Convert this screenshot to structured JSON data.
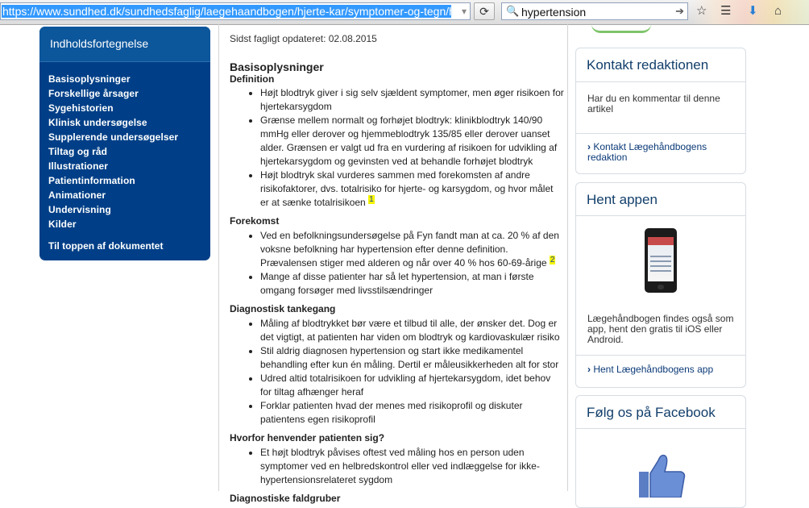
{
  "browser": {
    "url": "https://www.sundhed.dk/sundhedsfaglig/laegehaandbogen/hjerte-kar/symptomer-og-tegn/hoejt",
    "search_value": "hypertension"
  },
  "toc": {
    "title": "Indholdsfortegnelse",
    "items": [
      "Basisoplysninger",
      "Forskellige årsager",
      "Sygehistorien",
      "Klinisk undersøgelse",
      "Supplerende undersøgelser",
      "Tiltag og råd",
      "Illustrationer",
      "Patientinformation",
      "Animationer",
      "Undervisning",
      "Kilder"
    ],
    "to_top": "Til toppen af dokumentet"
  },
  "main": {
    "updated": "Sidst fagligt opdateret: 02.08.2015",
    "section_title": "Basisoplysninger",
    "definition": {
      "title": "Definition",
      "items": [
        "Højt blodtryk giver i sig selv sjældent symptomer, men øger risikoen for hjertekarsygdom",
        "Grænse mellem normalt og forhøjet blodtryk: klinikblodtryk 140/90 mmHg eller derover og hjemmeblodtryk 135/85 eller derover uanset alder. Grænsen er valgt ud fra en vurdering af risikoen for udvikling af hjertekarsygdom og gevinsten ved at behandle forhøjet blodtryk",
        "Højt blodtryk skal vurderes sammen med forekomsten af andre risikofaktorer, dvs. totalrisiko for hjerte- og karsygdom, og hvor målet er at sænke totalrisikoen"
      ],
      "ref": "1"
    },
    "forekomst": {
      "title": "Forekomst",
      "items": [
        "Ved en befolkningsundersøgelse på Fyn fandt man at ca. 20 % af den voksne befolkning har hypertension efter denne definition. Prævalensen stiger med alderen og når over 40 % hos 60-69-årige",
        "Mange af disse patienter har så let hypertension, at man i første omgang forsøger med livsstilsændringer"
      ],
      "ref": "2"
    },
    "diagnostisk": {
      "title": "Diagnostisk tankegang",
      "items": [
        "Måling af blodtrykket bør være et tilbud til alle, der ønsker det. Dog er det vigtigt, at patienten har viden om blodtryk og kardiovaskulær risiko",
        "Stil aldrig diagnosen hypertension og start ikke medikamentel behandling efter kun én måling. Dertil er måleusikkerheden alt for stor",
        "Udred altid totalrisikoen for udvikling af hjertekarsygdom, idet behov for tiltag afhænger heraf",
        "Forklar patienten hvad der menes med risikoprofil og diskuter patientens egen risikoprofil"
      ]
    },
    "hvorfor": {
      "title": "Hvorfor henvender patienten sig?",
      "items": [
        "Et højt blodtryk påvises oftest ved måling hos en person uden symptomer ved en helbredskontrol eller ved indlæggelse for ikke-hypertensionsrelateret sygdom"
      ]
    },
    "faldgruber_title": "Diagnostiske faldgruber"
  },
  "sidebar": {
    "kontakt": {
      "title": "Kontakt redaktionen",
      "text": "Har du en kommentar til denne artikel",
      "link": "Kontakt Lægehåndbogens redaktion"
    },
    "appen": {
      "title": "Hent appen",
      "text": "Lægehåndbogen findes også som app, hent den gratis til iOS eller Android.",
      "link": "Hent Lægehåndbogens app"
    },
    "facebook": {
      "title": "Følg os på Facebook"
    }
  },
  "colors": {
    "toc_bg": "#003f87",
    "toc_header": "#0c569c",
    "card_title": "#123f6b",
    "link": "#0b3a78",
    "ref_highlight": "#f4f400"
  }
}
